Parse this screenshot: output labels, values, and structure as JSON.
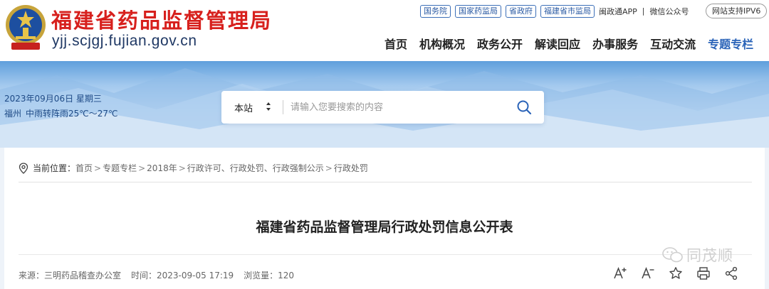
{
  "header": {
    "site_name": "福建省药品监督管理局",
    "site_domain": "yjj.scjgj.fujian.gov.cn",
    "top_links": [
      "国务院",
      "国家药监局",
      "省政府",
      "福建省市监局"
    ],
    "app_link": "闽政通APP",
    "wechat_link": "微信公众号",
    "ipv6_badge": "网站支持IPV6",
    "nav": [
      "首页",
      "机构概况",
      "政务公开",
      "解读回应",
      "办事服务",
      "互动交流",
      "专题专栏"
    ],
    "active_nav": "专题专栏"
  },
  "banner": {
    "date": "2023年09月06日 星期三",
    "city": "福州",
    "weather": "中雨转阵雨25℃～27℃"
  },
  "search": {
    "scope": "本站",
    "placeholder": "请输入您要搜索的内容",
    "value": ""
  },
  "breadcrumb": {
    "lead": "当前位置：",
    "items": [
      "首页",
      "专题专栏",
      "2018年",
      "行政许可、行政处罚、行政强制公示",
      "行政处罚"
    ],
    "separator": ">"
  },
  "article": {
    "title": "福建省药品监督管理局行政处罚信息公开表",
    "source": "来源：三明药品稽查办公室",
    "time": "时间：2023-09-05 17:19",
    "views": "浏览量：120"
  },
  "tools": [
    "font-increase-icon",
    "font-decrease-icon",
    "star-icon",
    "print-icon",
    "share-icon"
  ],
  "watermark": "同茂顺",
  "colors": {
    "brand_red": "#d7201d",
    "domain_navy": "#1f3864",
    "nav_active": "#2a63b8",
    "banner_sky": "#5f9fdc"
  }
}
